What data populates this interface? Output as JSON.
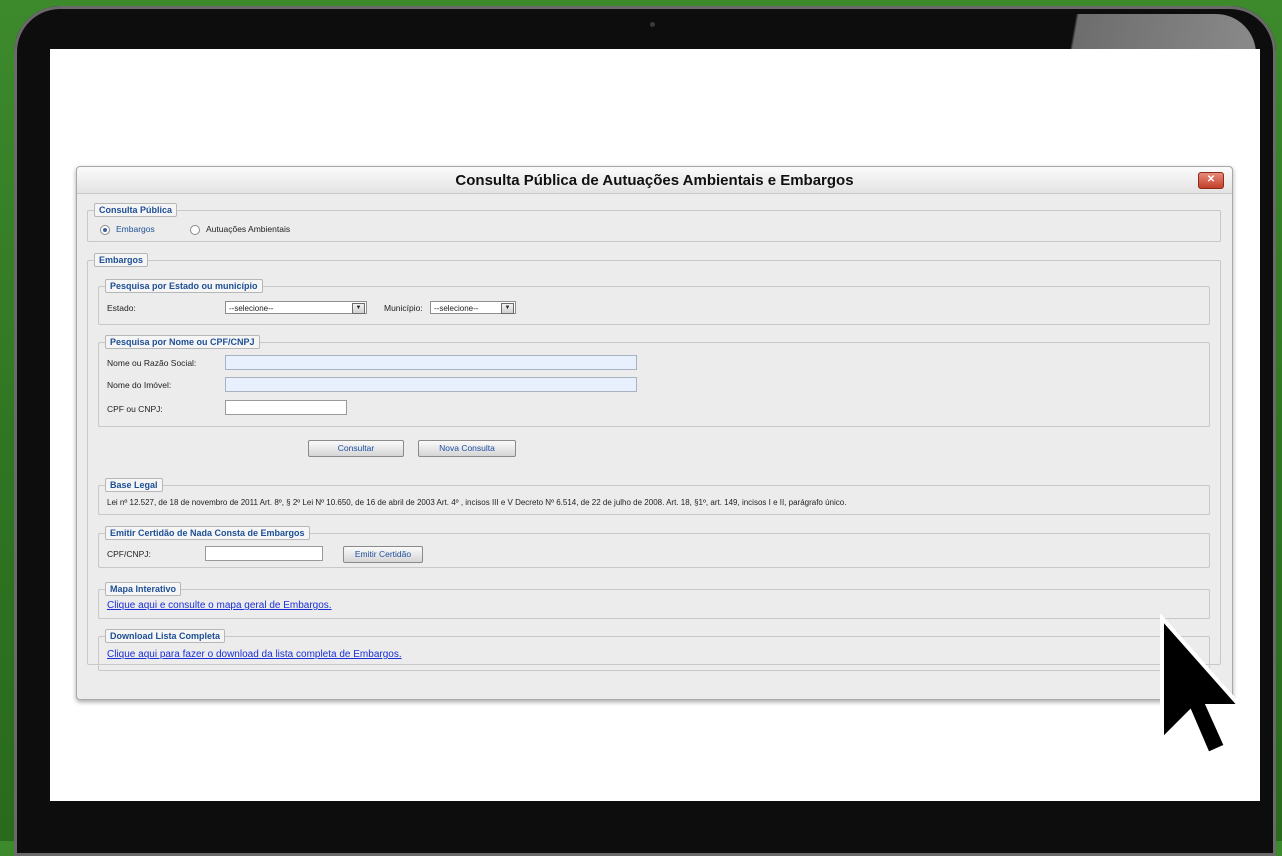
{
  "window": {
    "title": "Consulta Pública de Autuações Ambientais e Embargos"
  },
  "consulta_publica": {
    "legend": "Consulta Pública",
    "options": [
      "Embargos",
      "Autuações Ambientais"
    ],
    "selected": "Embargos"
  },
  "embargos": {
    "legend": "Embargos",
    "pesquisa_estado": {
      "legend": "Pesquisa por Estado ou município",
      "estado_label": "Estado:",
      "estado_value": "--selecione--",
      "municipio_label": "Município:",
      "municipio_value": "--selecione--"
    },
    "pesquisa_nome": {
      "legend": "Pesquisa por Nome ou CPF/CNPJ",
      "nome_label": "Nome ou Razão Social:",
      "imovel_label": "Nome do Imóvel:",
      "cpf_label": "CPF ou CNPJ:"
    },
    "consultar_label": "Consultar",
    "nova_consulta_label": "Nova Consulta",
    "base_legal": {
      "legend": "Base Legal",
      "text": "Lei nº 12.527, de 18 de novembro de 2011 Art. 8º, § 2º Lei Nº 10.650, de 16 de abril de 2003 Art. 4º , incisos III e V Decreto Nº 6.514, de 22 de julho de 2008. Art. 18, §1º, art. 149, incisos I e II, parágrafo único."
    },
    "certidao": {
      "legend": "Emitir Certidão de Nada Consta de Embargos",
      "cpf_label": "CPF/CNPJ:",
      "button": "Emitir Certidão"
    },
    "mapa": {
      "legend": "Mapa Interativo",
      "link": "Clique aqui e consulte o mapa geral de Embargos."
    },
    "download": {
      "legend": "Download Lista Completa",
      "link": "Clique aqui para fazer o download da lista completa de Embargos."
    }
  },
  "icons": {
    "close": "close-icon",
    "cursor": "hand-pointer-icon",
    "dropdown": "chevron-down-icon"
  }
}
